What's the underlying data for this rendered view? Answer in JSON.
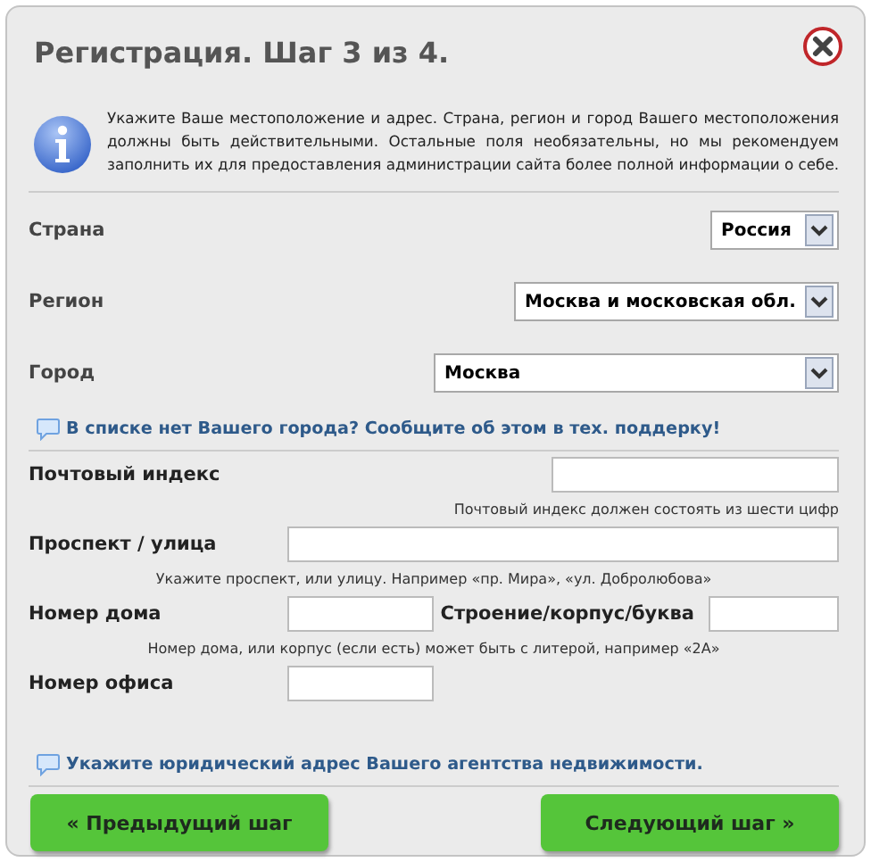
{
  "title": "Регистрация. Шаг 3 из 4.",
  "info": "Укажите Ваше местоположение и адрес. Страна, регион и город Вашего местоположения должны быть действительными. Остальные поля необязательны, но мы рекомендуем заполнить их для предоставления администрации сайта более полной информации о себе.",
  "location_fields": [
    {
      "label": "Страна",
      "value": "Россия"
    },
    {
      "label": "Регион",
      "value": "Москва и московская обл."
    },
    {
      "label": "Город",
      "value": "Москва"
    }
  ],
  "city_notice": "В списке нет Вашего города? Сообщите об этом в тех. поддерку!",
  "address_rows": [
    {
      "kind": "input",
      "label": "Почтовый индекс"
    },
    {
      "kind": "hint",
      "text": "Почтовый индекс должен состоять из шести цифр"
    },
    {
      "kind": "input",
      "label": "Проспект / улица"
    },
    {
      "kind": "hint",
      "text": "Укажите проспект, или улицу. Например «пр. Мира», «ул. Добролюбова»"
    },
    {
      "kind": "pair",
      "label": "Номер дома",
      "label2": "Строение/корпус/буква"
    },
    {
      "kind": "hint",
      "text": "Номер дома, или корпус (если есть) может быть с литерой, например «2А»"
    },
    {
      "kind": "input",
      "label": "Номер офиса"
    }
  ],
  "legal_notice": "Укажите юридический адрес Вашего агентства недвижимости.",
  "buttons": {
    "prev": "« Предыдущий шаг",
    "next": "Следующий шаг »"
  }
}
